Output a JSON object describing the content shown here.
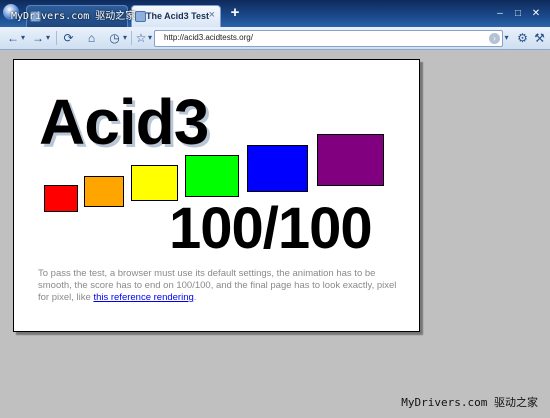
{
  "browser": {
    "tabs": [
      {
        "label": "",
        "close": "×"
      },
      {
        "label": "The Acid3 Test",
        "close": "×"
      }
    ],
    "new_tab": "+",
    "window_controls": [
      "–",
      "□",
      "✕"
    ],
    "toolbar": {
      "back": "←",
      "back_menu": "▾",
      "forward": "→",
      "forward_menu": "▾",
      "reload": "⟳",
      "home": "⌂",
      "history": "◷",
      "history_menu": "▾",
      "bookmark": "☆",
      "bookmark_menu": "▾",
      "address": "http://acid3.acidtests.org/",
      "go": "›",
      "address_menu": "▾",
      "settings": "⚙",
      "tools": "⚒"
    }
  },
  "page": {
    "title": "Acid3",
    "score": "100/100",
    "square_colors": [
      "#ff0000",
      "#ffa500",
      "#ffff00",
      "#00ff00",
      "#0000ff",
      "#800080"
    ],
    "description": "To pass the test, a browser must use its default settings, the animation has to be smooth, the score has to end on 100/100, and the final page has to look exactly, pixel for pixel, like ",
    "link_text": "this reference rendering",
    "description_end": "."
  },
  "watermarks": {
    "top": "MyDrivers.com 驱动之家",
    "bottom": "MyDrivers.com 驱动之家"
  }
}
